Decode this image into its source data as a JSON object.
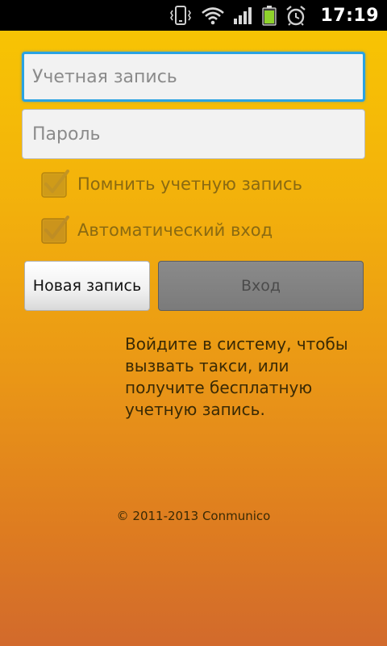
{
  "status_bar": {
    "time": "17:19",
    "icons": [
      "vibrate-icon",
      "wifi-icon",
      "signal-icon",
      "battery-icon",
      "alarm-icon"
    ]
  },
  "login": {
    "account_placeholder": "Учетная запись",
    "account_value": "",
    "password_placeholder": "Пароль",
    "password_value": "",
    "remember_label": "Помнить учетную запись",
    "remember_checked": true,
    "auto_login_label": "Автоматический вход",
    "auto_login_checked": true,
    "new_account_label": "Новая запись",
    "login_label": "Вход"
  },
  "info_text": "Войдите в систему, чтобы вызвать такси, или получите бесплатную учетную запись.",
  "copyright": "© 2011-2013 Conmunico",
  "colors": {
    "focus_border": "#2aa3e2",
    "bg_top": "#f8c702",
    "bg_bottom": "#d26a2c"
  }
}
